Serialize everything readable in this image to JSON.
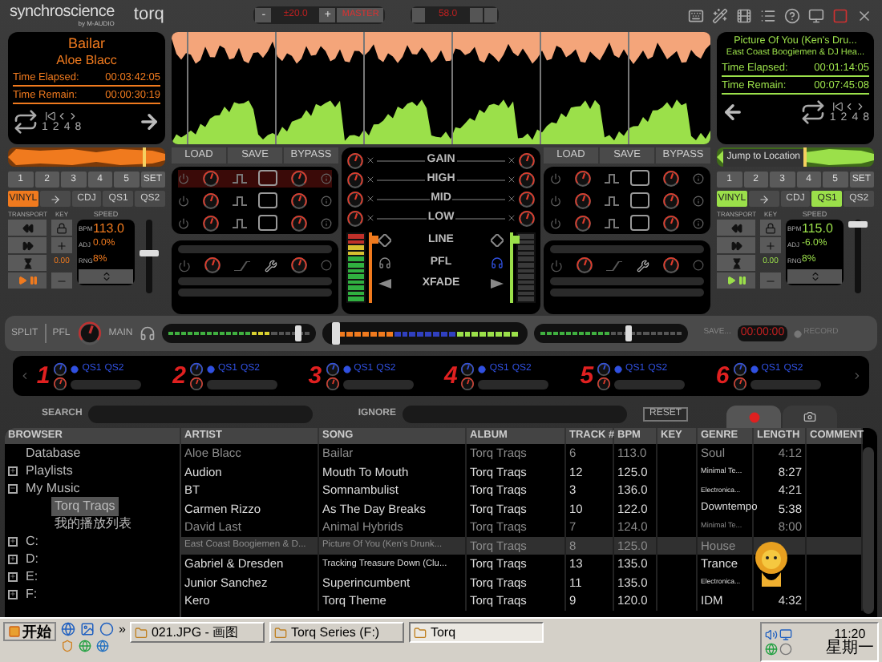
{
  "top_bar": {
    "brand": "synchroscience",
    "brand_sub": "by M-AUDIO",
    "product": "torq",
    "minus": "-",
    "pitch_range": "±20.0",
    "plus": "+",
    "master": "MASTER",
    "tempo": "58.0"
  },
  "decks": [
    {
      "color": "#f07a1e",
      "title": "Bailar",
      "artist": "Aloe Blacc",
      "elapsed_label": "Time Elapsed:",
      "elapsed": "00:03:42:05",
      "remain_label": "Time Remain:",
      "remain": "00:00:30:19",
      "loop_sizes": [
        "1",
        "2",
        "4",
        "8"
      ],
      "position": {
        "level": 0.88
      },
      "cues": [
        "1",
        "2",
        "3",
        "4",
        "5",
        "SET"
      ],
      "modes": [
        {
          "label": "VINYL",
          "selected": true
        },
        {
          "label": "CDJ",
          "selected": false
        },
        {
          "label": "QS1",
          "selected": false
        },
        {
          "label": "QS2",
          "selected": false
        }
      ],
      "fx_buttons": [
        "LOAD",
        "SAVE",
        "BYPASS"
      ],
      "transport_label": "TRANSPORT",
      "key_label": "KEY",
      "speed_label": "SPEED",
      "key": "0.00",
      "bpm_label": "BPM",
      "bpm": "113.0",
      "adj_label": "ADJ",
      "adj": "0.0%",
      "rng_label": "RNG",
      "rng": "8%",
      "pitch": {
        "level": 0.55
      },
      "meter": {
        "level": 1
      },
      "fader": {
        "level": 0.95
      },
      "volume": {
        "level": 0.95
      }
    },
    {
      "color": "#9be04a",
      "title": "Picture Of You (Ken's Dru...",
      "artist": "East Coast Boogiemen & DJ Hea...",
      "elapsed_label": "Time Elapsed:",
      "elapsed": "00:01:14:05",
      "remain_label": "Time Remain:",
      "remain": "00:07:45:08",
      "loop_sizes": [
        "1",
        "2",
        "4",
        "8"
      ],
      "position": {
        "level": 0.56
      },
      "tooltip": "Jump to Location",
      "cues": [
        "1",
        "2",
        "3",
        "4",
        "5",
        "SET"
      ],
      "modes": [
        {
          "label": "VINYL",
          "selected": true
        },
        {
          "label": "CDJ",
          "selected": false
        },
        {
          "label": "QS1",
          "selected": true
        },
        {
          "label": "QS2",
          "selected": false
        }
      ],
      "fx_buttons": [
        "LOAD",
        "SAVE",
        "BYPASS"
      ],
      "transport_label": "TRANSPORT",
      "key_label": "KEY",
      "speed_label": "SPEED",
      "key": "0.00",
      "bpm_label": "BPM",
      "bpm": "115.0",
      "adj_label": "ADJ",
      "adj": "-6.0%",
      "rng_label": "RNG",
      "rng": "8%",
      "pitch": {
        "level": 0.98
      },
      "meter": {
        "level": 0
      },
      "fader": {
        "level": 0.95
      },
      "volume": {
        "level": 0.65
      }
    }
  ],
  "mixer": {
    "bands": [
      "GAIN",
      "HIGH",
      "MID",
      "LOW"
    ],
    "line": "LINE",
    "pfl": "PFL",
    "xfade": "XFADE"
  },
  "output": {
    "split": "SPLIT",
    "pfl": "PFL",
    "main": "MAIN",
    "crossfader": {
      "level": 0.05
    },
    "save": "SAVE...",
    "record_time": "00:00:00",
    "record": "RECORD"
  },
  "sampler": [
    {
      "number": "1",
      "buttons": [
        "QS1",
        "QS2"
      ]
    },
    {
      "number": "2",
      "buttons": [
        "QS1",
        "QS2"
      ]
    },
    {
      "number": "3",
      "buttons": [
        "QS1",
        "QS2"
      ]
    },
    {
      "number": "4",
      "buttons": [
        "QS1",
        "QS2"
      ]
    },
    {
      "number": "5",
      "buttons": [
        "QS1",
        "QS2"
      ]
    },
    {
      "number": "6",
      "buttons": [
        "QS1",
        "QS2"
      ]
    }
  ],
  "search": {
    "search_label": "SEARCH",
    "ignore_label": "IGNORE",
    "reset": "RESET",
    "tabs": [
      {
        "kind": "record",
        "selected": true
      },
      {
        "kind": "camera",
        "selected": false
      }
    ]
  },
  "browser": {
    "tree_header": "BROWSER",
    "tree": [
      {
        "label": "Database",
        "selected": false
      },
      {
        "label": "Playlists",
        "selected": false,
        "expanded": false
      },
      {
        "label": "My Music",
        "selected": false,
        "expanded": true,
        "children": [
          {
            "label": "Torq Traqs",
            "selected": true
          },
          {
            "label": "我的播放列表",
            "selected": false
          }
        ]
      },
      {
        "label": "C:",
        "selected": false,
        "expanded": false
      },
      {
        "label": "D:",
        "selected": false,
        "expanded": false
      },
      {
        "label": "E:",
        "selected": false,
        "expanded": false
      },
      {
        "label": "F:",
        "selected": false,
        "expanded": false
      }
    ],
    "columns": [
      "ARTIST",
      "SONG",
      "ALBUM",
      "TRACK #",
      "BPM",
      "KEY",
      "GENRE",
      "LENGTH",
      "COMMENT"
    ],
    "rows": [
      {
        "artist": "Aloe Blacc",
        "song": "Bailar",
        "album": "Torq Traqs",
        "track": "6",
        "bpm": "113.0",
        "genre": "Soul",
        "length": "4:12",
        "dimmed": true,
        "selected": false
      },
      {
        "artist": "Audion",
        "song": "Mouth To Mouth",
        "album": "Torq Traqs",
        "track": "12",
        "bpm": "125.0",
        "genre": "Minimal Te...",
        "length": "8:27",
        "dimmed": false,
        "selected": false
      },
      {
        "artist": "BT",
        "song": "Somnambulist",
        "album": "Torq Traqs",
        "track": "3",
        "bpm": "136.0",
        "genre": "Electronica...",
        "length": "4:21",
        "dimmed": false,
        "selected": false
      },
      {
        "artist": "Carmen Rizzo",
        "song": "As The Day Breaks",
        "album": "Torq Traqs",
        "track": "10",
        "bpm": "122.0",
        "genre": "Downtempo",
        "length": "5:38",
        "dimmed": false,
        "selected": false
      },
      {
        "artist": "David Last",
        "song": "Animal Hybrids",
        "album": "Torq Traqs",
        "track": "7",
        "bpm": "124.0",
        "genre": "Minimal Te...",
        "length": "8:00",
        "dimmed": true,
        "selected": false
      },
      {
        "artist": "East Coast Boogiemen & D...",
        "song": "Picture Of You (Ken's Drunk...",
        "album": "Torq Traqs",
        "track": "8",
        "bpm": "125.0",
        "genre": "House",
        "dimmed": true,
        "selected": true
      },
      {
        "artist": "Gabriel & Dresden",
        "song": "Tracking Treasure Down (Clu...",
        "album": "Torq Traqs",
        "track": "13",
        "bpm": "135.0",
        "genre": "Trance",
        "dimmed": false,
        "selected": false
      },
      {
        "artist": "Junior Sanchez",
        "song": "Superincumbent",
        "album": "Torq Traqs",
        "track": "11",
        "bpm": "135.0",
        "genre": "Electronica...",
        "dimmed": false,
        "selected": false
      },
      {
        "artist": "Kero",
        "song": "Torq Theme",
        "album": "Torq Traqs",
        "track": "9",
        "bpm": "120.0",
        "genre": "IDM",
        "length": "4:32",
        "dimmed": false,
        "selected": false
      }
    ]
  },
  "taskbar": {
    "start": "开始",
    "more": "»",
    "tasks": [
      {
        "label": "021.JPG - 画图",
        "selected": false
      },
      {
        "label": "Torq Series (F:)",
        "selected": false
      },
      {
        "label": "Torq",
        "selected": true
      }
    ],
    "time": "11:20",
    "day": "星期一"
  }
}
